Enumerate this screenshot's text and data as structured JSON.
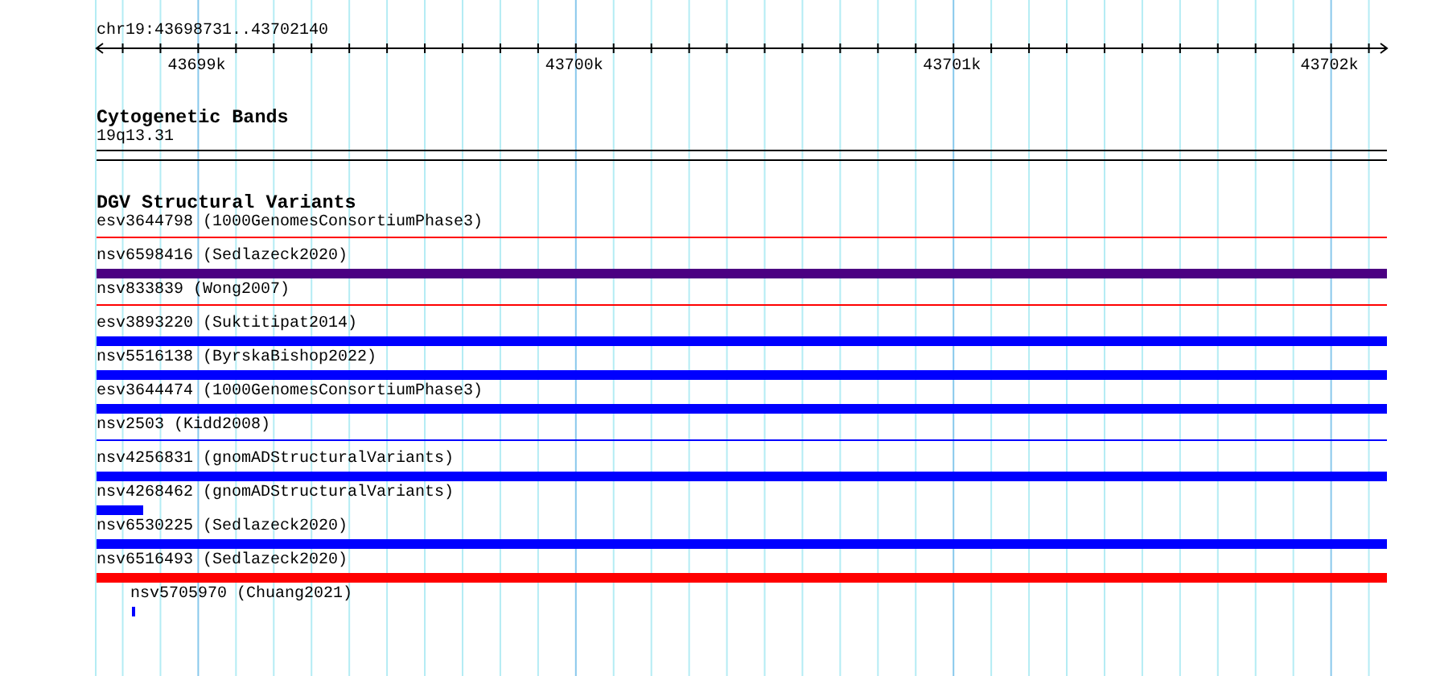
{
  "ruler": {
    "location": "chr19:43698731..43702140",
    "ticks": [
      "43699k",
      "43700k",
      "43701k",
      "43702k"
    ]
  },
  "cytogenetic_bands": {
    "title": "Cytogenetic Bands",
    "band": "19q13.31"
  },
  "dgv_track": {
    "title": "DGV Structural Variants",
    "features": [
      {
        "label": "esv3644798 (1000GenomesConsortiumPhase3)",
        "kind": "thin",
        "color": "#ff0000"
      },
      {
        "label": "nsv6598416 (Sedlazeck2020)",
        "kind": "thick",
        "color": "#4b0082"
      },
      {
        "label": "nsv833839 (Wong2007)",
        "kind": "thin",
        "color": "#ff0000"
      },
      {
        "label": "esv3893220 (Suktitipat2014)",
        "kind": "thick",
        "color": "#0000ff"
      },
      {
        "label": "nsv5516138 (ByrskaBishop2022)",
        "kind": "thick",
        "color": "#0000ff"
      },
      {
        "label": "esv3644474 (1000GenomesConsortiumPhase3)",
        "kind": "thick",
        "color": "#0000ff"
      },
      {
        "label": "nsv2503 (Kidd2008)",
        "kind": "thin",
        "color": "#0000ff"
      },
      {
        "label": "nsv4256831 (gnomADStructuralVariants)",
        "kind": "thick",
        "color": "#0000ff"
      },
      {
        "label": "nsv4268462 (gnomADStructuralVariants)",
        "kind": "short",
        "color": "#0000ff"
      },
      {
        "label": "nsv6530225 (Sedlazeck2020)",
        "kind": "thick",
        "color": "#0000ff"
      },
      {
        "label": "nsv6516493 (Sedlazeck2020)",
        "kind": "thick",
        "color": "#ff0000"
      },
      {
        "label": "nsv5705970 (Chuang2021)",
        "kind": "marker",
        "color": "#0000ff"
      }
    ]
  }
}
